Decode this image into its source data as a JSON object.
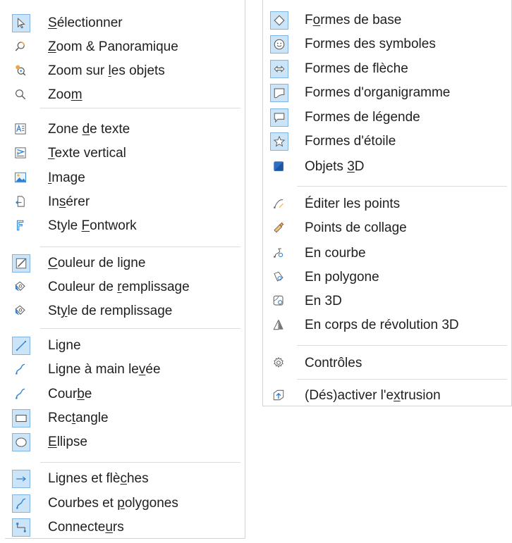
{
  "left_menu": {
    "items": [
      {
        "id": "selectionner",
        "pre": "",
        "key": "S",
        "post": "électionner",
        "icon": "select-cursor-icon",
        "selected": true
      },
      {
        "id": "zoom-panoramique",
        "pre": "",
        "key": "Z",
        "post": "oom & Panoramique",
        "icon": "zoom-pan-icon",
        "selected": false
      },
      {
        "id": "zoom-objets",
        "pre": "Zoom sur ",
        "key": "l",
        "post": "es objets",
        "icon": "zoom-objects-icon",
        "selected": false
      },
      {
        "id": "zoom",
        "pre": "Zoo",
        "key": "m",
        "post": "",
        "icon": "zoom-icon",
        "selected": false
      },
      {
        "id": "zone-texte",
        "pre": "Zone ",
        "key": "d",
        "post": "e texte",
        "icon": "text-box-icon",
        "selected": false
      },
      {
        "id": "texte-vertical",
        "pre": "",
        "key": "T",
        "post": "exte vertical",
        "icon": "vertical-text-icon",
        "selected": false
      },
      {
        "id": "image",
        "pre": "",
        "key": "I",
        "post": "mage",
        "icon": "image-icon",
        "selected": false
      },
      {
        "id": "inserer",
        "pre": "In",
        "key": "s",
        "post": "érer",
        "icon": "insert-icon",
        "selected": false
      },
      {
        "id": "style-fontwork",
        "pre": "Style ",
        "key": "F",
        "post": "ontwork",
        "icon": "fontwork-icon",
        "selected": false
      },
      {
        "id": "couleur-ligne",
        "pre": "",
        "key": "C",
        "post": "ouleur de ligne",
        "icon": "line-color-icon",
        "selected": true
      },
      {
        "id": "couleur-remplissage",
        "pre": "Couleur de ",
        "key": "r",
        "post": "emplissage",
        "icon": "fill-color-icon",
        "selected": false
      },
      {
        "id": "style-remplissage",
        "pre": "St",
        "key": "y",
        "post": "le de remplissage",
        "icon": "fill-style-icon",
        "selected": false
      },
      {
        "id": "ligne",
        "pre": "Li",
        "key": "g",
        "post": "ne",
        "icon": "line-icon",
        "selected": true
      },
      {
        "id": "ligne-main-levee",
        "pre": "Ligne à main le",
        "key": "v",
        "post": "ée",
        "icon": "freeform-line-icon",
        "selected": false
      },
      {
        "id": "courbe",
        "pre": "Cour",
        "key": "b",
        "post": "e",
        "icon": "curve-icon",
        "selected": false
      },
      {
        "id": "rectangle",
        "pre": "Rec",
        "key": "t",
        "post": "angle",
        "icon": "rectangle-icon",
        "selected": true
      },
      {
        "id": "ellipse",
        "pre": "",
        "key": "E",
        "post": "llipse",
        "icon": "ellipse-icon",
        "selected": true
      },
      {
        "id": "lignes-fleches",
        "pre": "Lignes et flè",
        "key": "c",
        "post": "hes",
        "icon": "lines-arrows-icon",
        "selected": true
      },
      {
        "id": "courbes-polygones",
        "pre": "Courbes et ",
        "key": "p",
        "post": "olygones",
        "icon": "curves-polygons-icon",
        "selected": true
      },
      {
        "id": "connecteurs",
        "pre": "Connecte",
        "key": "u",
        "post": "rs",
        "icon": "connector-icon",
        "selected": true
      }
    ]
  },
  "right_menu": {
    "items": [
      {
        "id": "formes-base",
        "pre": "F",
        "key": "o",
        "post": "rmes de base",
        "icon": "diamond-shape-icon",
        "selected": true
      },
      {
        "id": "formes-symboles",
        "pre": "Formes des symboles",
        "key": "",
        "post": "",
        "icon": "smiley-icon",
        "selected": true
      },
      {
        "id": "formes-fleche",
        "pre": "Formes de flèche",
        "key": "",
        "post": "",
        "icon": "double-arrow-icon",
        "selected": true
      },
      {
        "id": "formes-organigramme",
        "pre": "Formes d'organigramme",
        "key": "",
        "post": "",
        "icon": "flowchart-icon",
        "selected": true
      },
      {
        "id": "formes-legende",
        "pre": "Formes de légende",
        "key": "",
        "post": "",
        "icon": "callout-icon",
        "selected": true
      },
      {
        "id": "formes-etoile",
        "pre": "Formes d'étoile",
        "key": "",
        "post": "",
        "icon": "star-icon",
        "selected": true
      },
      {
        "id": "objets-3d",
        "pre": "Objets ",
        "key": "3",
        "post": "D",
        "icon": "cube-3d-icon",
        "selected": false
      },
      {
        "id": "editer-points",
        "pre": "Éditer les points",
        "key": "",
        "post": "",
        "icon": "edit-points-icon",
        "selected": false
      },
      {
        "id": "points-collage",
        "pre": "Points de collage",
        "key": "",
        "post": "",
        "icon": "glue-points-icon",
        "selected": false
      },
      {
        "id": "en-courbe",
        "pre": "En courbe",
        "key": "",
        "post": "",
        "icon": "to-curve-icon",
        "selected": false
      },
      {
        "id": "en-polygone",
        "pre": "En polygone",
        "key": "",
        "post": "",
        "icon": "to-polygon-icon",
        "selected": false
      },
      {
        "id": "en-3d",
        "pre": "En 3D",
        "key": "",
        "post": "",
        "icon": "to-3d-icon",
        "selected": false
      },
      {
        "id": "en-corps-revolution",
        "pre": "En corps de révolution 3D",
        "key": "",
        "post": "",
        "icon": "rotation-object-icon",
        "selected": false
      },
      {
        "id": "controles",
        "pre": "Contrôles",
        "key": "",
        "post": "",
        "icon": "controls-gear-icon",
        "selected": false
      },
      {
        "id": "activer-extrusion",
        "pre": "(Dés)activer l'e",
        "key": "x",
        "post": "trusion",
        "icon": "extrusion-icon",
        "selected": false
      }
    ]
  },
  "colors": {
    "accent_blue": "#2a7fd4",
    "selected_bg": "#cce4f7",
    "selected_border": "#7fb4e4",
    "separator": "#dcdcdc"
  }
}
